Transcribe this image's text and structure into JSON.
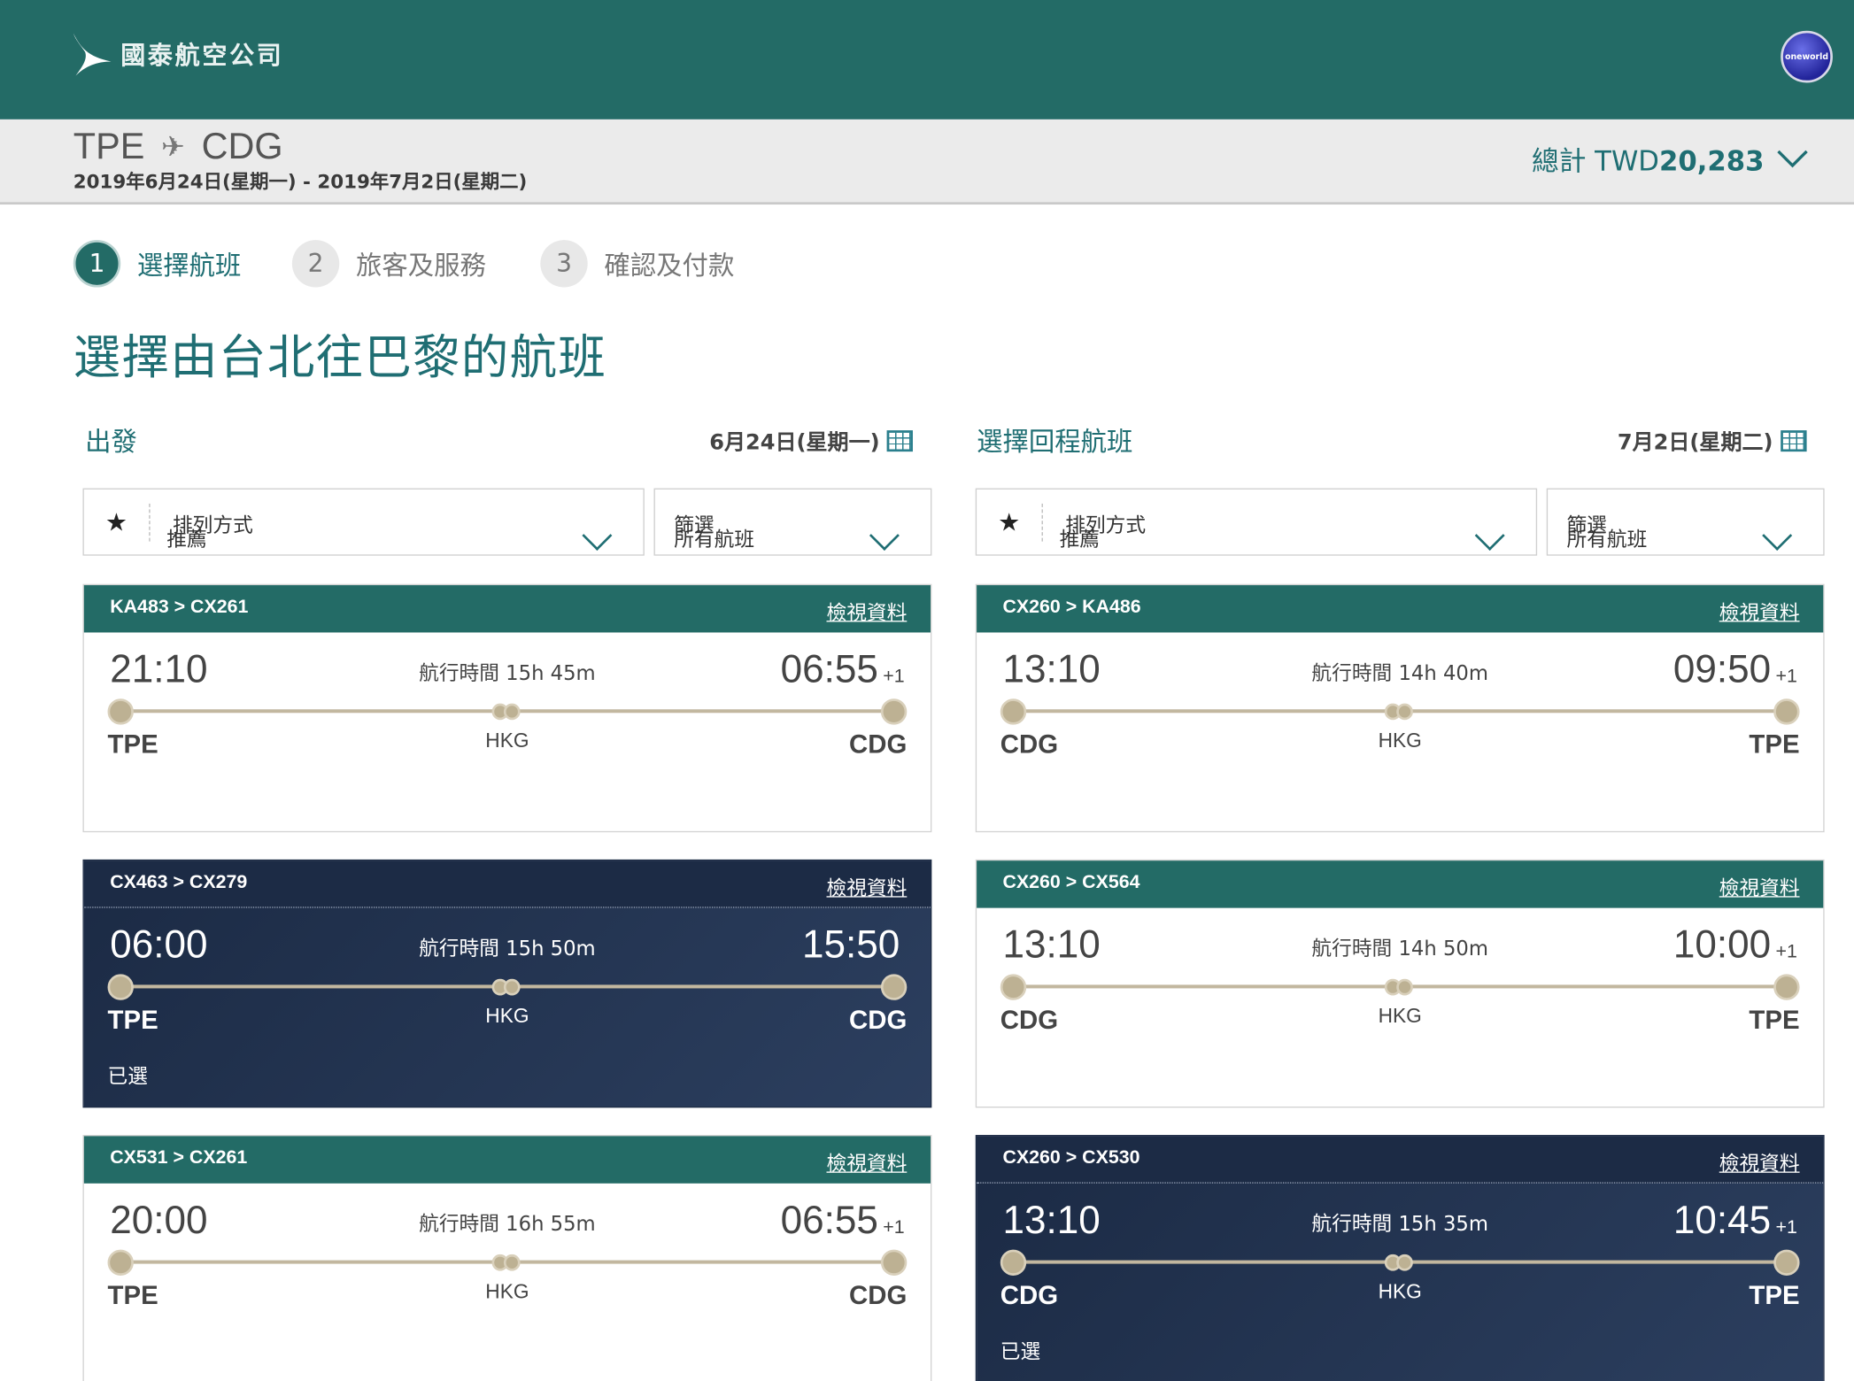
{
  "header": {
    "logo_text": "國泰航空公司",
    "alliance_badge": "oneworld"
  },
  "route": {
    "origin": "TPE",
    "destination": "CDG",
    "plane_icon": "airplane-icon",
    "dates": "2019年6月24日(星期一) - 2019年7月2日(星期二)",
    "total_label": "總計 TWD",
    "total_amount": "20,283"
  },
  "steps": [
    {
      "num": "1",
      "label": "選擇航班"
    },
    {
      "num": "2",
      "label": "旅客及服務"
    },
    {
      "num": "3",
      "label": "確認及付款"
    }
  ],
  "page_title": "選擇由台北往巴黎的航班",
  "outbound": {
    "heading": "出發",
    "date": "6月24日(星期一)",
    "sort_label": "排列方式",
    "sort_value": "推薦",
    "filter_label": "篩選",
    "filter_value": "所有航班"
  },
  "inbound": {
    "heading": "選擇回程航班",
    "date": "7月2日(星期二)",
    "sort_label": "排列方式",
    "sort_value": "推薦",
    "filter_label": "篩選",
    "filter_value": "所有航班"
  },
  "details_label": "檢視資料",
  "duration_prefix": "航行時間",
  "selected_label": "已選",
  "outbound_flights": [
    {
      "flights": "KA483 > CX261",
      "dep": "21:10",
      "arr": "06:55",
      "plus": "+1",
      "duration": "航行時間 15h 45m",
      "origin": "TPE",
      "stop": "HKG",
      "dest": "CDG",
      "selected": false
    },
    {
      "flights": "CX463 > CX279",
      "dep": "06:00",
      "arr": "15:50",
      "plus": "",
      "duration": "航行時間 15h 50m",
      "origin": "TPE",
      "stop": "HKG",
      "dest": "CDG",
      "selected": true
    },
    {
      "flights": "CX531 > CX261",
      "dep": "20:00",
      "arr": "06:55",
      "plus": "+1",
      "duration": "航行時間 16h 55m",
      "origin": "TPE",
      "stop": "HKG",
      "dest": "CDG",
      "selected": false
    }
  ],
  "inbound_flights": [
    {
      "flights": "CX260 > KA486",
      "dep": "13:10",
      "arr": "09:50",
      "plus": "+1",
      "duration": "航行時間 14h 40m",
      "origin": "CDG",
      "stop": "HKG",
      "dest": "TPE",
      "selected": false
    },
    {
      "flights": "CX260 > CX564",
      "dep": "13:10",
      "arr": "10:00",
      "plus": "+1",
      "duration": "航行時間 14h 50m",
      "origin": "CDG",
      "stop": "HKG",
      "dest": "TPE",
      "selected": false
    },
    {
      "flights": "CX260 > CX530",
      "dep": "13:10",
      "arr": "10:45",
      "plus": "+1",
      "duration": "航行時間 15h 35m",
      "origin": "CDG",
      "stop": "HKG",
      "dest": "TPE",
      "selected": true
    }
  ],
  "colors": {
    "brand_teal": "#236b66",
    "selected_navy": "#1b2a44",
    "timeline_gold": "#bdb193"
  }
}
